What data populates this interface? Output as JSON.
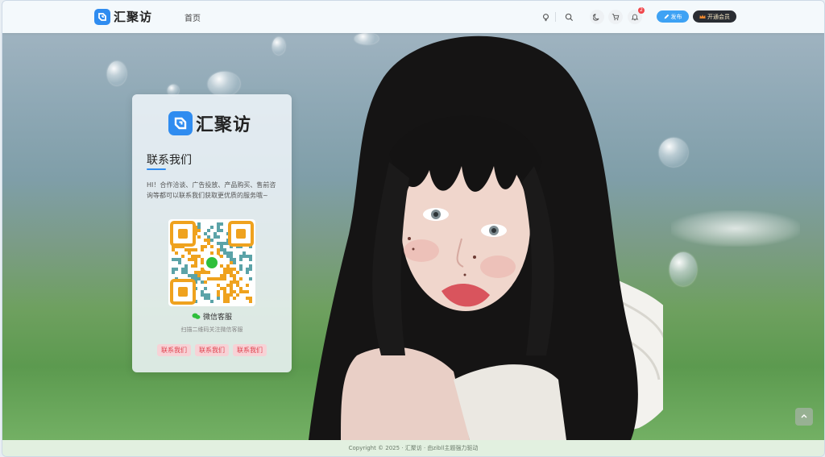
{
  "brand": {
    "name": "汇聚访",
    "accent": "#2f8cf0"
  },
  "nav": {
    "home": "首页"
  },
  "header": {
    "notification_count": "2",
    "publish_label": "发布",
    "vip_label": "开通会员"
  },
  "contact_card": {
    "title": "联系我们",
    "description": "HI！合作洽谈、广告投放、产品购买、售前咨询等都可以联系我们获取更优质的服务哦~",
    "wechat_label": "微信客服",
    "scan_tip": "扫描二维码关注微信客服",
    "buttons": [
      "联系我们",
      "联系我们",
      "联系我们"
    ]
  },
  "footer": {
    "copyright": "Copyright © 2025 · 汇聚访 · 由zibll主题强力驱动"
  },
  "icons": {
    "logo": "logo-icon",
    "search": "search-icon",
    "theme": "moon-icon",
    "cart": "cart-icon",
    "bell": "bell-icon",
    "pencil": "pencil-icon",
    "crown": "crown-icon",
    "wechat": "wechat-icon",
    "back_to_top": "arrow-up-icon"
  }
}
